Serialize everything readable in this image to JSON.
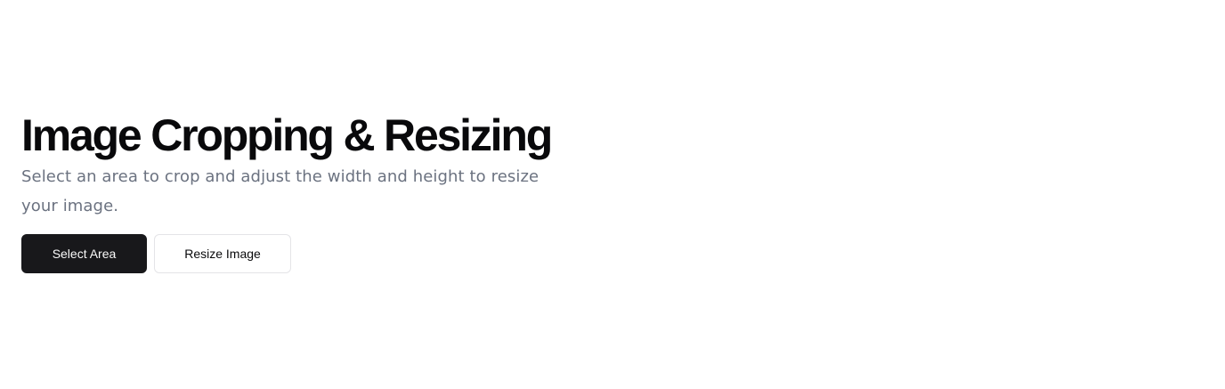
{
  "hero": {
    "title": "Image Cropping & Resizing",
    "subtitle": "Select an area to crop and adjust the width and height to resize your image."
  },
  "actions": {
    "select_area_label": "Select Area",
    "resize_image_label": "Resize Image"
  },
  "colors": {
    "primary_button_bg": "#18181b",
    "text_muted": "#6b7280",
    "title": "#09090b"
  }
}
